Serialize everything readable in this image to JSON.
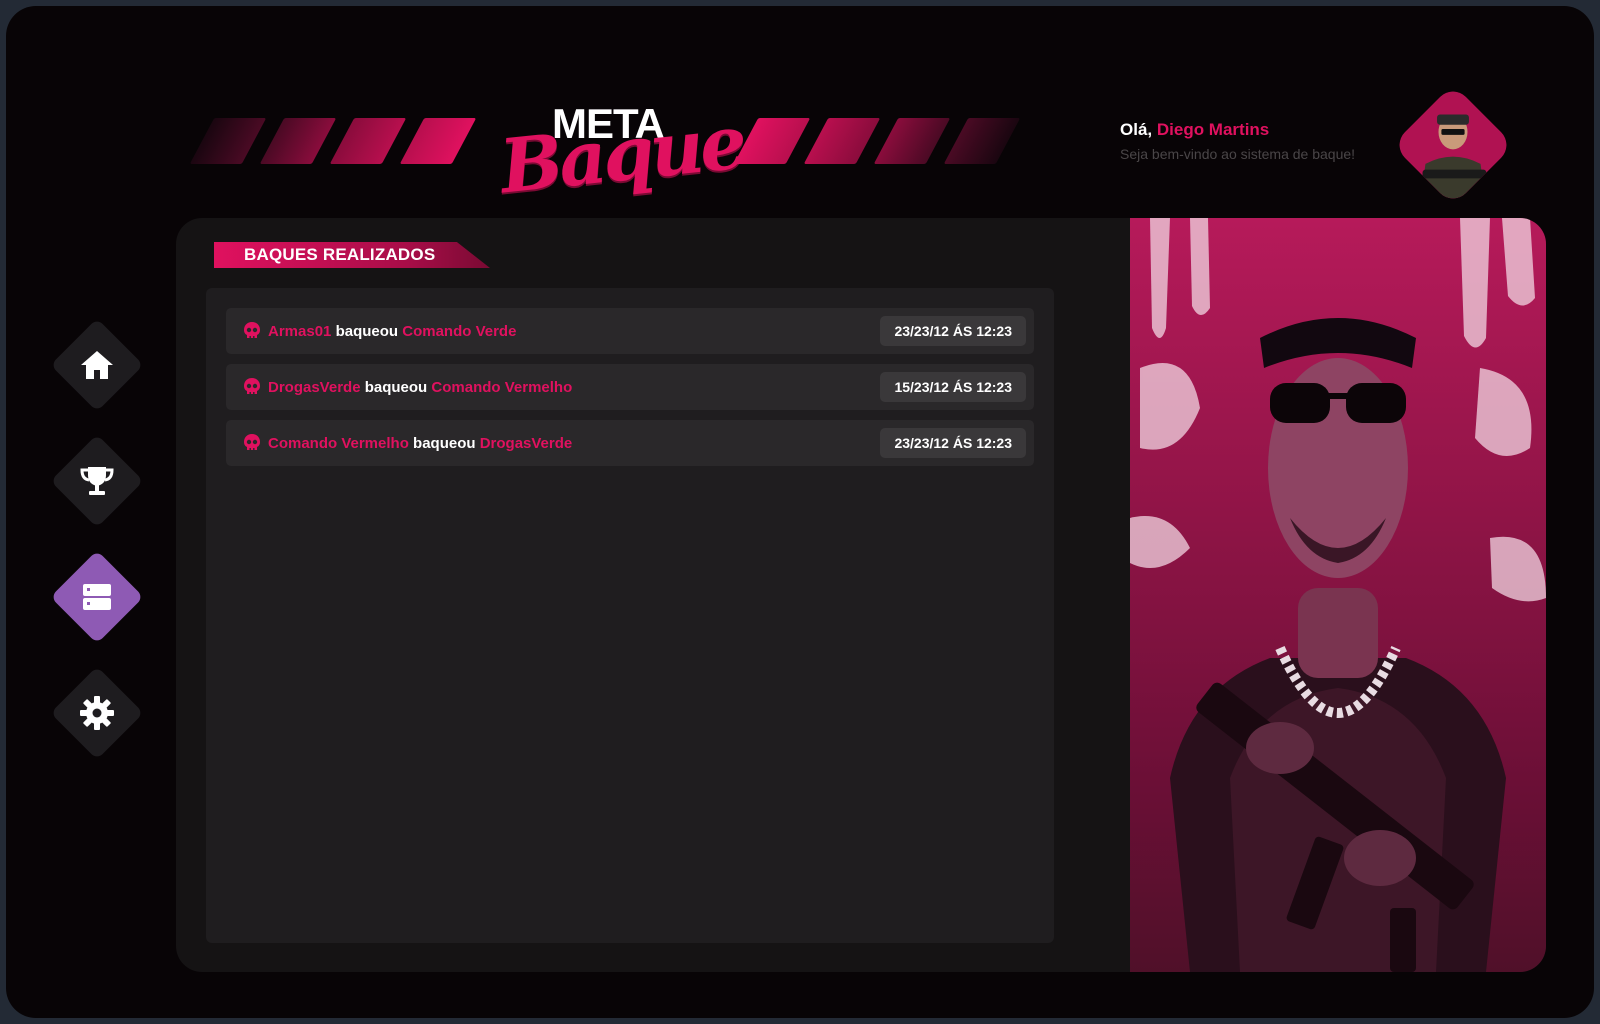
{
  "brand": {
    "word_top": "META",
    "word_script": "Baque"
  },
  "user": {
    "greeting": "Olá,",
    "name": "Diego Martins",
    "subtitle": "Seja bem-vindo ao sistema de baque!"
  },
  "nav": [
    {
      "icon": "home-icon"
    },
    {
      "icon": "trophy-icon"
    },
    {
      "icon": "server-icon",
      "active": true
    },
    {
      "icon": "gear-icon"
    }
  ],
  "section": {
    "title": "BAQUES REALIZADOS"
  },
  "baques": [
    {
      "attacker": "Armas01",
      "verb": "baqueou",
      "target": "Comando Verde",
      "date": "23/23/12 ÁS 12:23"
    },
    {
      "attacker": "DrogasVerde",
      "verb": "baqueou",
      "target": "Comando Vermelho",
      "date": "15/23/12 ÁS 12:23"
    },
    {
      "attacker": "Comando Vermelho",
      "verb": "baqueou",
      "target": "DrogasVerde",
      "date": "23/23/12 ÁS 12:23"
    }
  ],
  "colors": {
    "accent": "#e0115f",
    "active_nav": "#8e5ab4",
    "background": "#080406",
    "panel": "#151314"
  }
}
